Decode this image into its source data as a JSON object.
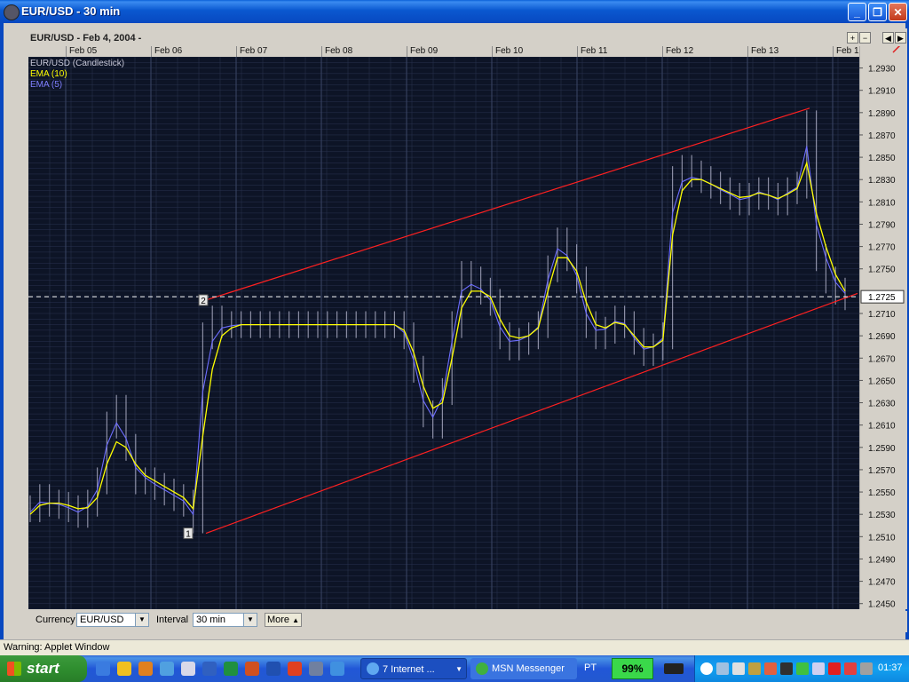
{
  "window": {
    "title": "EUR/USD - 30 min",
    "icon": "app-globe-icon"
  },
  "chart": {
    "header": "EUR/USD - Feb 4, 2004 -",
    "legend": [
      {
        "label": "EUR/USD (Candlestick)",
        "color": "#c8c8d8"
      },
      {
        "label": "EMA (10)",
        "color": "#ffff00"
      },
      {
        "label": "EMA (5)",
        "color": "#7f7fff"
      }
    ],
    "dates": [
      "Feb 05",
      "Feb 06",
      "Feb 07",
      "Feb 08",
      "Feb 09",
      "Feb 10",
      "Feb 11",
      "Feb 12",
      "Feb 13",
      "Feb 1"
    ],
    "current_price_label": "1.2725",
    "markers": [
      "1",
      "2"
    ],
    "colors": {
      "background": "#0d1426",
      "grid": "#2a3350",
      "price": "#b4b4cc",
      "ema10": "#ffff00",
      "ema5": "#6d6dff",
      "channel": "#ff2020"
    }
  },
  "chart_data": {
    "type": "line",
    "title": "EUR/USD - Feb 4, 2004 -",
    "x_ticks": [
      "Feb 05",
      "Feb 06",
      "Feb 07",
      "Feb 08",
      "Feb 09",
      "Feb 10",
      "Feb 11",
      "Feb 12",
      "Feb 13",
      "Feb 1"
    ],
    "y_ticks": [
      "1.2930",
      "1.2910",
      "1.2890",
      "1.2870",
      "1.2850",
      "1.2830",
      "1.2810",
      "1.2790",
      "1.2770",
      "1.2750",
      "1.2710",
      "1.2690",
      "1.2670",
      "1.2650",
      "1.2630",
      "1.2610",
      "1.2590",
      "1.2570",
      "1.2550",
      "1.2530",
      "1.2510",
      "1.2490",
      "1.2470",
      "1.2450"
    ],
    "ylim": [
      1.2445,
      1.294
    ],
    "series": [
      {
        "name": "EUR/USD (Candlestick)",
        "values": [
          1.2535,
          1.2545,
          1.254,
          1.2538,
          1.2535,
          1.253,
          1.254,
          1.256,
          1.261,
          1.2625,
          1.259,
          1.256,
          1.256,
          1.2555,
          1.255,
          1.2545,
          1.254,
          1.2525,
          1.269,
          1.2705,
          1.27,
          1.27,
          1.27,
          1.27,
          1.27,
          1.27,
          1.27,
          1.27,
          1.27,
          1.27,
          1.27,
          1.27,
          1.27,
          1.27,
          1.27,
          1.27,
          1.27,
          1.27,
          1.27,
          1.269,
          1.266,
          1.262,
          1.261,
          1.264,
          1.27,
          1.2745,
          1.274,
          1.273,
          1.272,
          1.269,
          1.268,
          1.2685,
          1.269,
          1.27,
          1.275,
          1.2775,
          1.276,
          1.274,
          1.27,
          1.269,
          1.2695,
          1.2705,
          1.27,
          1.2685,
          1.2675,
          1.268,
          1.269,
          1.283,
          1.284,
          1.2835,
          1.283,
          1.2825,
          1.282,
          1.2815,
          1.281,
          1.2815,
          1.282,
          1.2815,
          1.281,
          1.282,
          1.2825,
          1.288,
          1.276,
          1.274,
          1.273,
          1.2725
        ]
      },
      {
        "name": "EMA (10)",
        "values": [
          1.253,
          1.2538,
          1.254,
          1.254,
          1.2538,
          1.2535,
          1.2536,
          1.2545,
          1.2575,
          1.2595,
          1.259,
          1.2575,
          1.2565,
          1.256,
          1.2555,
          1.255,
          1.2545,
          1.2535,
          1.26,
          1.266,
          1.269,
          1.2697,
          1.27,
          1.27,
          1.27,
          1.27,
          1.27,
          1.27,
          1.27,
          1.27,
          1.27,
          1.27,
          1.27,
          1.27,
          1.27,
          1.27,
          1.27,
          1.27,
          1.27,
          1.2695,
          1.2675,
          1.2645,
          1.2625,
          1.263,
          1.267,
          1.2715,
          1.273,
          1.273,
          1.2725,
          1.2705,
          1.269,
          1.2688,
          1.269,
          1.2697,
          1.273,
          1.276,
          1.276,
          1.2748,
          1.272,
          1.27,
          1.2697,
          1.2702,
          1.27,
          1.269,
          1.268,
          1.268,
          1.2686,
          1.278,
          1.282,
          1.283,
          1.283,
          1.2826,
          1.2822,
          1.2818,
          1.2814,
          1.2815,
          1.2818,
          1.2816,
          1.2813,
          1.2817,
          1.2822,
          1.2845,
          1.28,
          1.277,
          1.2745,
          1.273
        ]
      },
      {
        "name": "EMA (5)",
        "values": [
          1.2532,
          1.2541,
          1.254,
          1.2539,
          1.2536,
          1.2532,
          1.2537,
          1.2552,
          1.2592,
          1.2612,
          1.2598,
          1.2572,
          1.2563,
          1.2557,
          1.2552,
          1.2547,
          1.2542,
          1.253,
          1.264,
          1.2685,
          1.2697,
          1.2699,
          1.27,
          1.27,
          1.27,
          1.27,
          1.27,
          1.27,
          1.27,
          1.27,
          1.27,
          1.27,
          1.27,
          1.27,
          1.27,
          1.27,
          1.27,
          1.27,
          1.27,
          1.2693,
          1.2668,
          1.2632,
          1.2617,
          1.2635,
          1.2685,
          1.273,
          1.2736,
          1.2732,
          1.2722,
          1.2698,
          1.2685,
          1.2686,
          1.269,
          1.2698,
          1.274,
          1.2768,
          1.2762,
          1.2744,
          1.271,
          1.2695,
          1.2696,
          1.2703,
          1.2701,
          1.2688,
          1.2678,
          1.268,
          1.2688,
          1.28,
          1.2828,
          1.2832,
          1.283,
          1.2826,
          1.2821,
          1.2817,
          1.2812,
          1.2814,
          1.2819,
          1.2816,
          1.2812,
          1.2818,
          1.2823,
          1.286,
          1.279,
          1.276,
          1.2738,
          1.2728
        ]
      }
    ]
  },
  "controls": {
    "currency_label": "Currency",
    "currency_value": "EUR/USD",
    "interval_label": "Interval",
    "interval_value": "30 min",
    "more_label": "More"
  },
  "status": {
    "text": "Warning: Applet Window"
  },
  "taskbar": {
    "start_label": "start",
    "tasks": [
      {
        "label": "7 Internet ...",
        "icon": "internet-explorer-icon"
      },
      {
        "label": "MSN Messenger",
        "icon": "msn-messenger-icon"
      }
    ],
    "lang": "PT",
    "battery": "99%",
    "clock": "01:37"
  }
}
